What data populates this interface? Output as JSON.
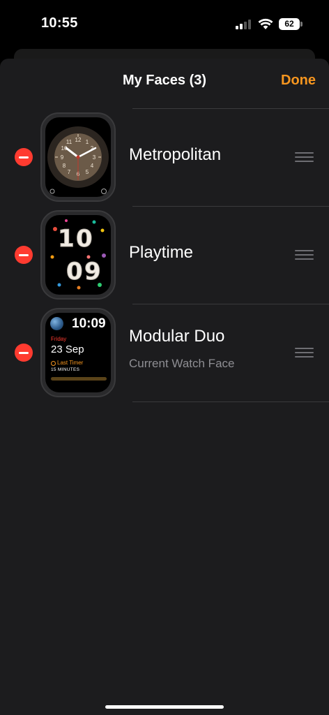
{
  "status": {
    "time": "10:55",
    "battery": "62"
  },
  "nav": {
    "title": "My Faces (3)",
    "done_label": "Done"
  },
  "faces": [
    {
      "name": "Metropolitan",
      "subtitle": ""
    },
    {
      "name": "Playtime",
      "subtitle": ""
    },
    {
      "name": "Modular Duo",
      "subtitle": "Current Watch Face"
    }
  ],
  "preview_modular": {
    "time": "10:09",
    "day": "Friday",
    "date": "23 Sep",
    "timer_label": "Last Timer",
    "timer_value": "15 MINUTES"
  },
  "preview_playtime": {
    "digits": [
      "1",
      "0",
      "0",
      "9"
    ]
  },
  "colors": {
    "accent": "#f7961f",
    "delete": "#ff3b30",
    "background": "#1c1c1e",
    "secondary_text": "#8e8e93"
  }
}
